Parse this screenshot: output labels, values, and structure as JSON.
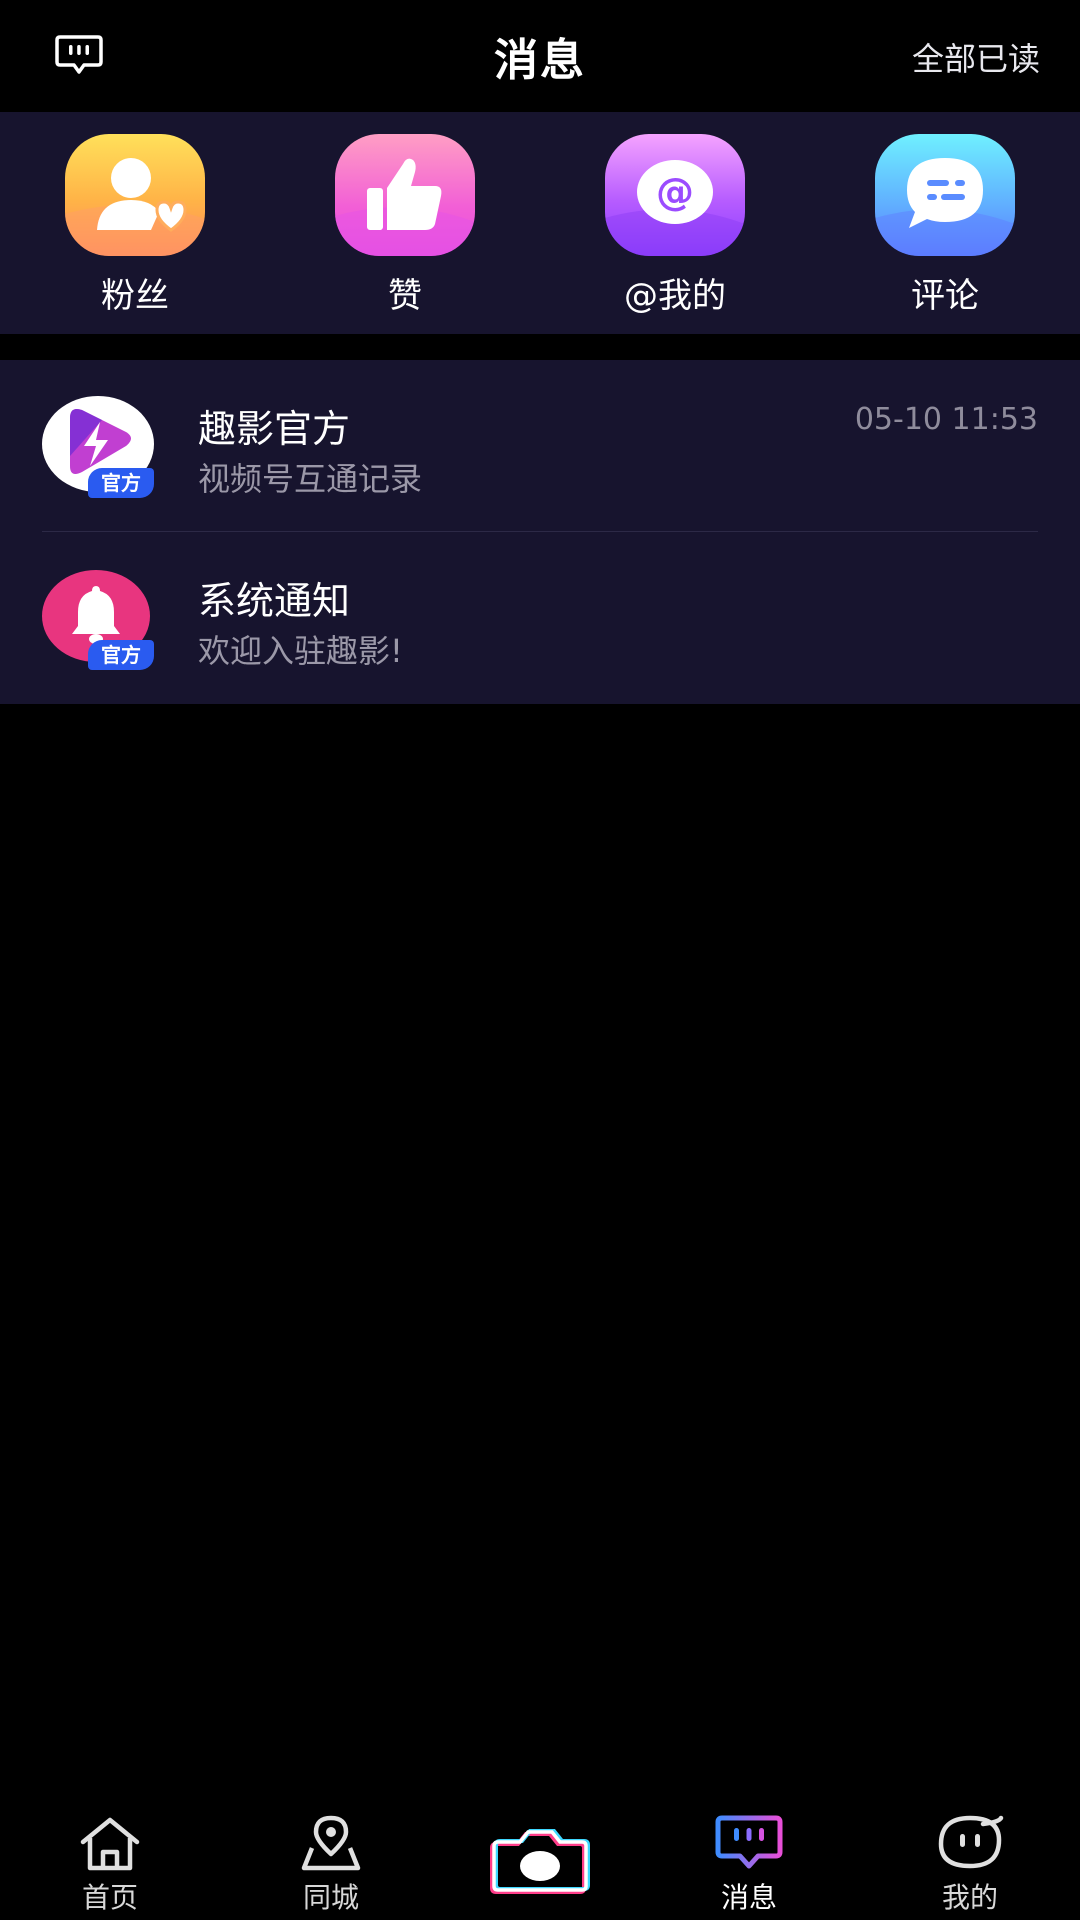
{
  "header": {
    "title": "消息",
    "action_label": "全部已读",
    "left_icon": "message-bubble-icon"
  },
  "shortcuts": [
    {
      "label": "粉丝",
      "icon": "fans-icon",
      "color": "#ffb347"
    },
    {
      "label": "赞",
      "icon": "thumbs-up-icon",
      "color": "#f25fd6"
    },
    {
      "label": "@我的",
      "icon": "mention-icon",
      "color": "#9a4dfc"
    },
    {
      "label": "评论",
      "icon": "comment-icon",
      "color": "#4a9bff"
    }
  ],
  "conversations": [
    {
      "name": "趣影官方",
      "preview": "视频号互通记录",
      "time": "05-10 11:53",
      "badge": "官方",
      "avatar_icon": "quying-logo-icon"
    },
    {
      "name": "系统通知",
      "preview": "欢迎入驻趣影!",
      "time": "",
      "badge": "官方",
      "avatar_icon": "bell-icon"
    }
  ],
  "bottom_nav": [
    {
      "label": "首页",
      "icon": "home-icon",
      "active": false
    },
    {
      "label": "同城",
      "icon": "location-icon",
      "active": false
    },
    {
      "label": "",
      "icon": "camera-icon",
      "active": false
    },
    {
      "label": "消息",
      "icon": "message-icon",
      "active": true
    },
    {
      "label": "我的",
      "icon": "profile-icon",
      "active": false
    }
  ],
  "colors": {
    "background": "#000000",
    "panel": "#17142e",
    "secondary_text": "#9b98a8",
    "badge_blue": "#2a5bf0"
  }
}
